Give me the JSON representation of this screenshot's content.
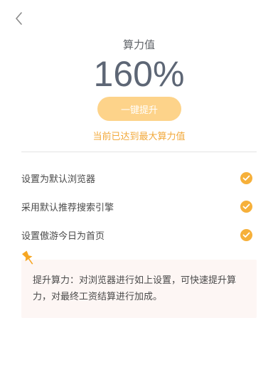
{
  "header": {
    "back_icon": "chevron-left-icon"
  },
  "score": {
    "title": "算力值",
    "value": "160%"
  },
  "boost_button": {
    "label": "一键提升"
  },
  "status": {
    "max_note": "当前已达到最大算力值"
  },
  "tasks": [
    {
      "label": "设置为默认浏览器",
      "done": true,
      "icon": "check-circle-icon"
    },
    {
      "label": "采用默认推荐搜索引擎",
      "done": true,
      "icon": "check-circle-icon"
    },
    {
      "label": "设置傲游今日为首页",
      "done": true,
      "icon": "check-circle-icon"
    }
  ],
  "tip": {
    "icon": "pushpin-icon",
    "text": "提升算力：对浏览器进行如上设置，可快速提升算力，对最终工资结算进行加成。"
  },
  "colors": {
    "accent": "#f6b03a",
    "button": "#fdd38a",
    "value_text": "#5d6675",
    "tip_bg": "#fdf6f4"
  }
}
